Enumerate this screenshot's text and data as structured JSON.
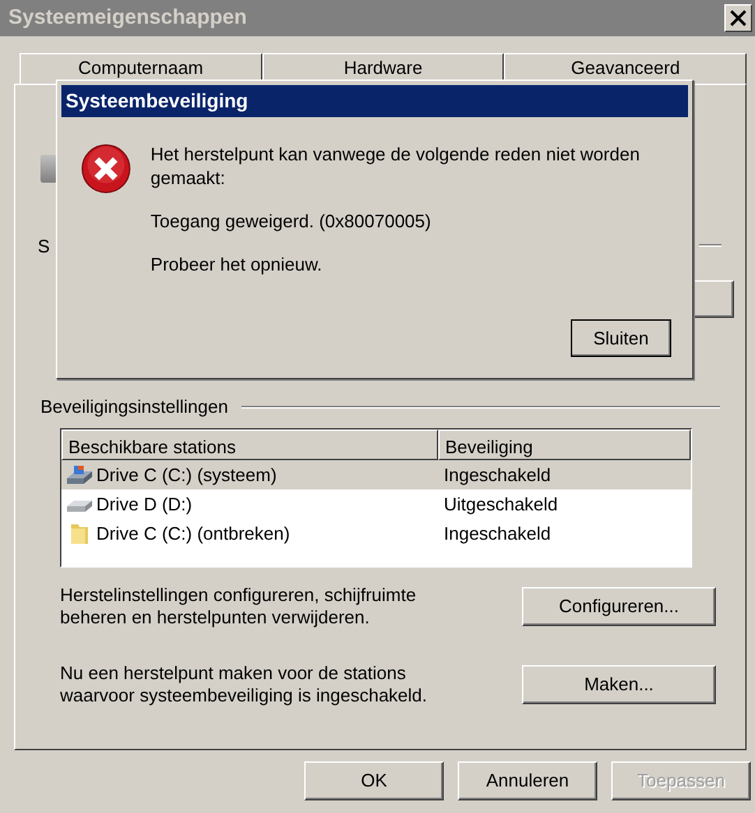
{
  "window": {
    "title": "Systeemeigenschappen"
  },
  "tabs": [
    {
      "label": "Computernaam",
      "selected": false
    },
    {
      "label": "Hardware",
      "selected": false
    },
    {
      "label": "Geavanceerd",
      "selected": false
    }
  ],
  "panel": {
    "obscured_label": "S"
  },
  "settings": {
    "title": "Beveiligingsinstellingen",
    "columns": [
      "Beschikbare stations",
      "Beveiliging"
    ],
    "rows": [
      {
        "kind": "system",
        "drive": "Drive C (C:) (systeem)",
        "protection": "Ingeschakeld",
        "selected": true
      },
      {
        "kind": "disk",
        "drive": "Drive D (D:)",
        "protection": "Uitgeschakeld",
        "selected": false
      },
      {
        "kind": "folder",
        "drive": "Drive C (C:) (ontbreken)",
        "protection": "Ingeschakeld",
        "selected": false
      }
    ]
  },
  "actions": [
    {
      "text": "Herstelinstellingen configureren, schijfruimte beheren en herstelpunten verwijderen.",
      "button": "Configureren..."
    },
    {
      "text": "Nu een herstelpunt maken voor de stations waarvoor systeembeveiliging is ingeschakeld.",
      "button": "Maken..."
    }
  ],
  "footer": [
    {
      "label": "OK",
      "disabled": false
    },
    {
      "label": "Annuleren",
      "disabled": false
    },
    {
      "label": "Toepassen",
      "disabled": true
    }
  ],
  "dialog": {
    "title": "Systeembeveiliging",
    "message": "Het herstelpunt kan vanwege de volgende reden niet worden gemaakt:",
    "detail": "Toegang geweigerd. (0x80070005)",
    "hint": "Probeer het opnieuw.",
    "button": "Sluiten"
  }
}
